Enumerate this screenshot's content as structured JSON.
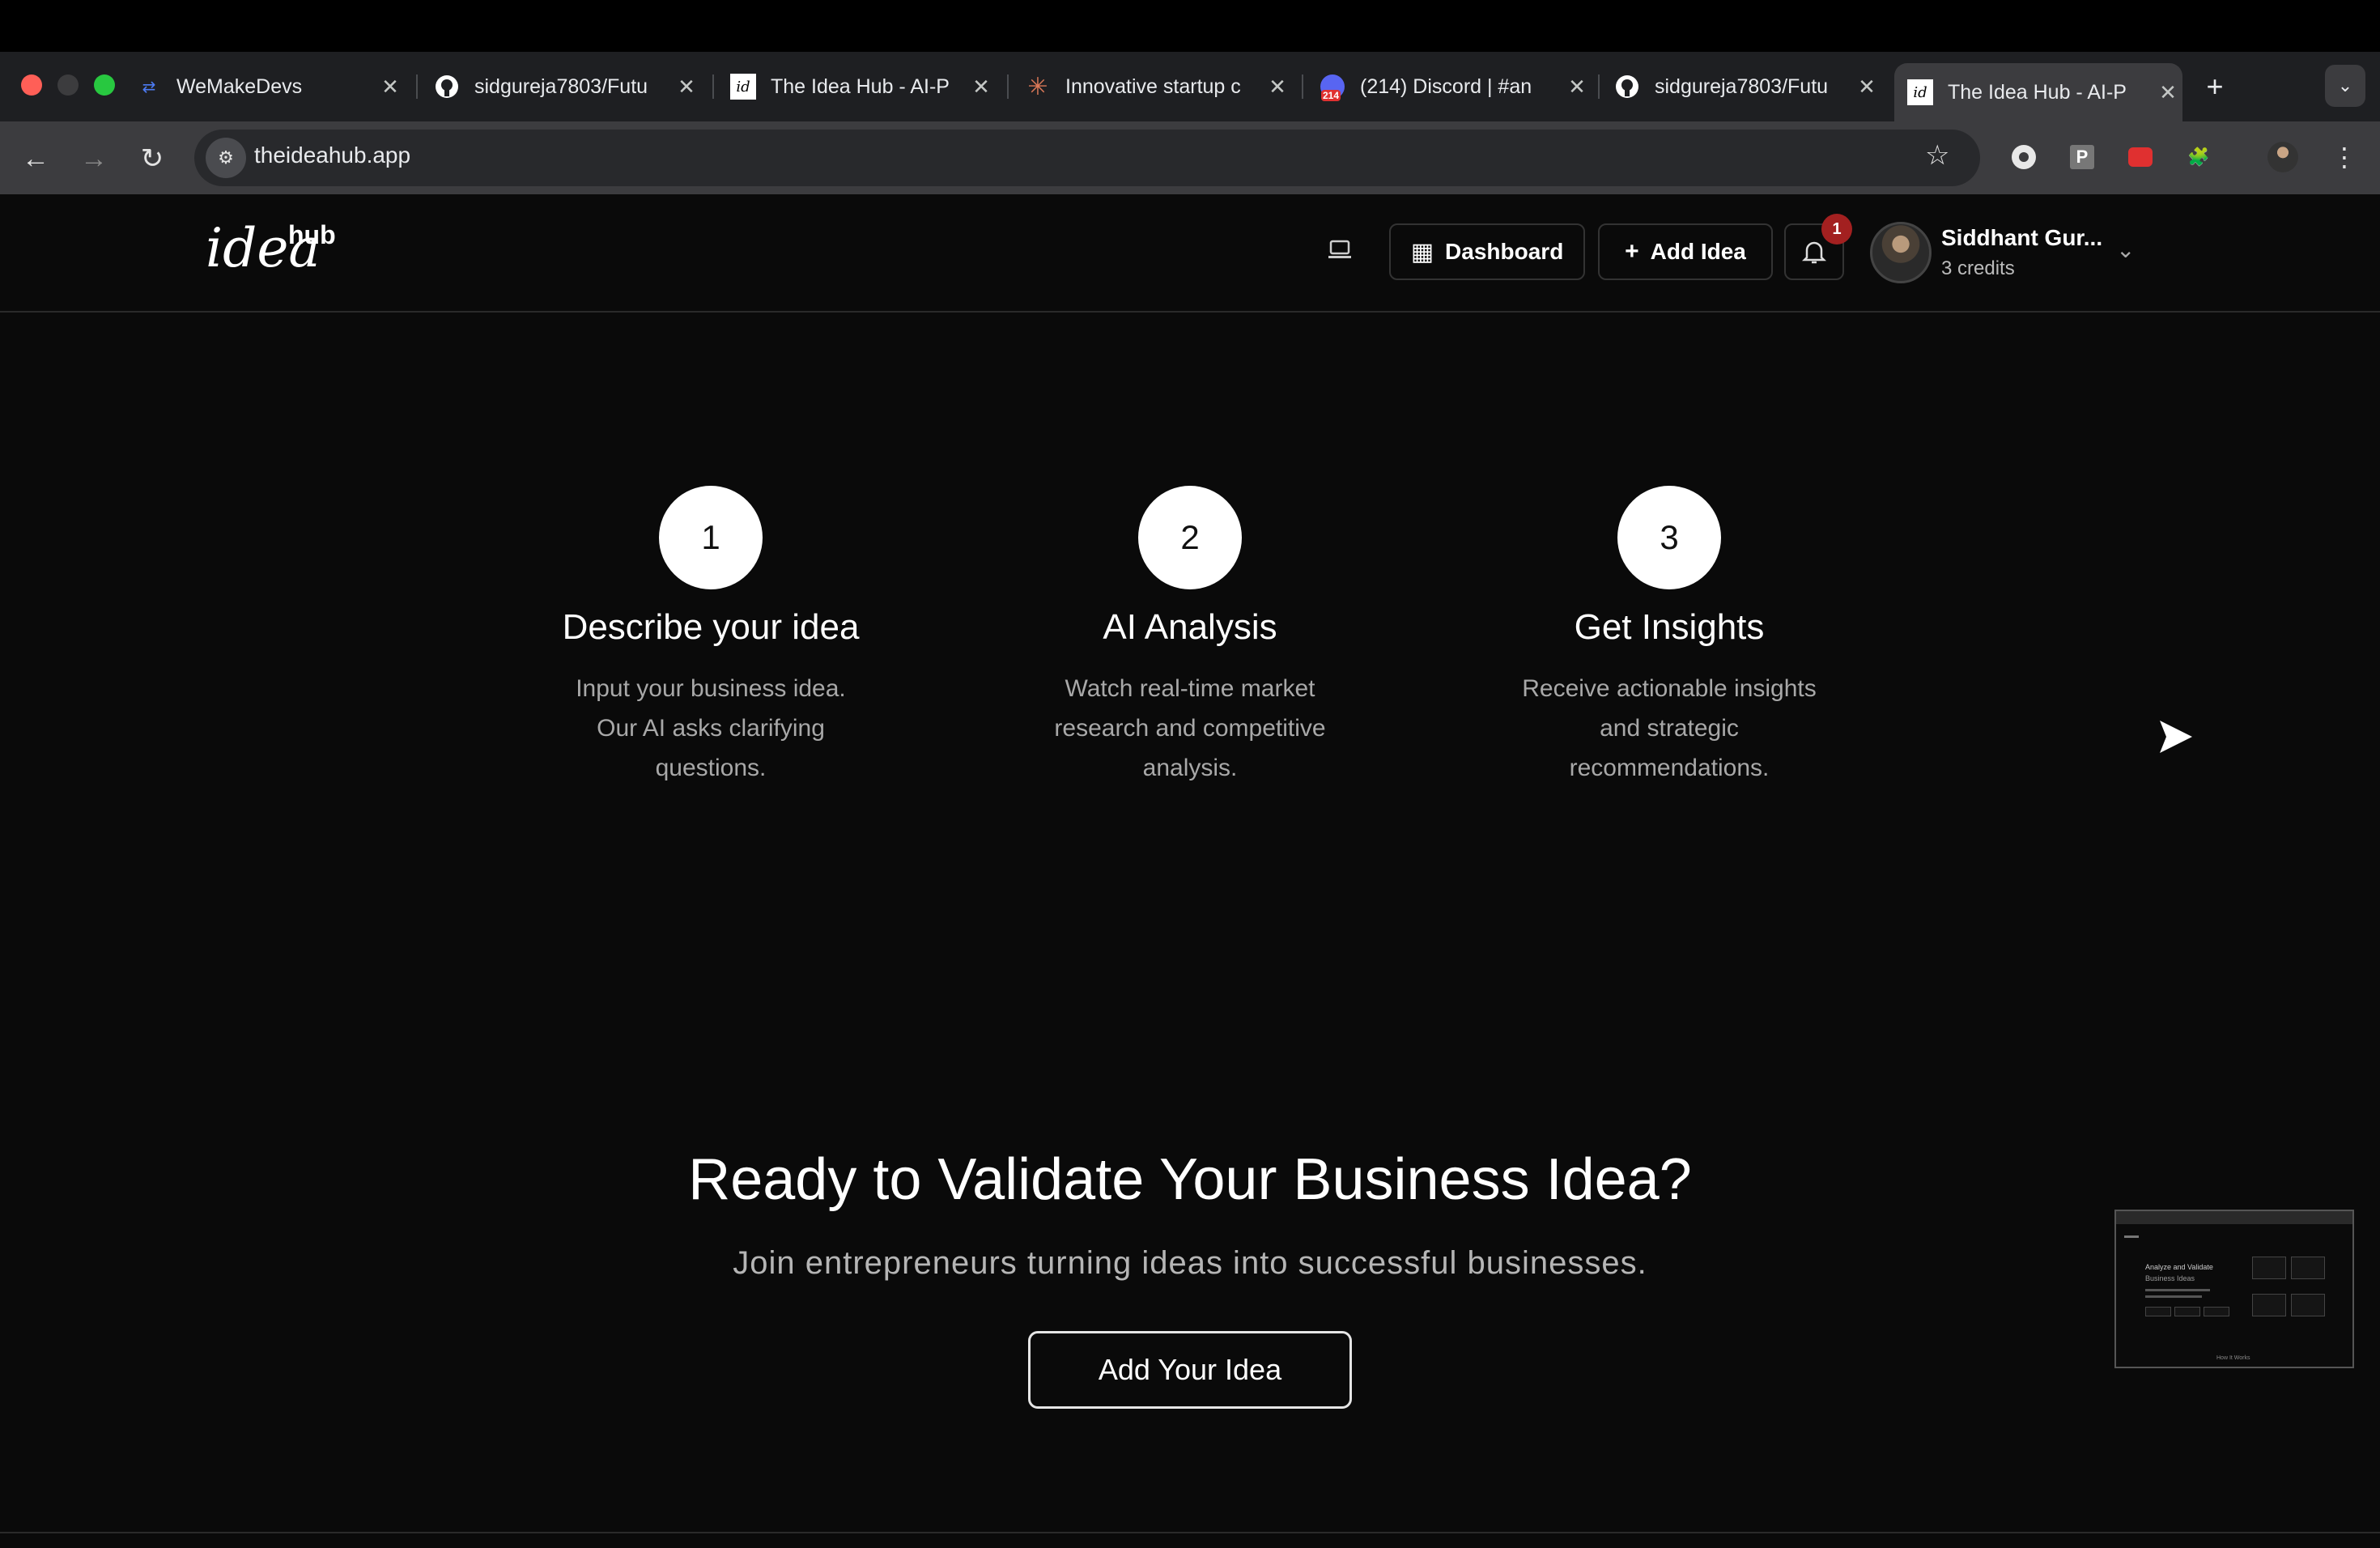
{
  "browser": {
    "tabs": [
      {
        "title": "WeMakeDevs",
        "icon": "wemakedevs-icon"
      },
      {
        "title": "sidgureja7803/Futu",
        "icon": "github-icon"
      },
      {
        "title": "The Idea Hub - AI-P",
        "icon": "ideahub-icon"
      },
      {
        "title": "Innovative startup c",
        "icon": "claude-icon"
      },
      {
        "title": "(214) Discord | #an",
        "icon": "discord-icon",
        "badge": "214"
      },
      {
        "title": "sidgureja7803/Futu",
        "icon": "github-icon"
      },
      {
        "title": "The Idea Hub - AI-P",
        "icon": "ideahub-icon",
        "active": true
      }
    ],
    "url": "theideahub.app",
    "extensions": [
      "perplexity-icon",
      "p-extension-icon",
      "youtube-extension-icon",
      "puzzle-icon",
      "profile-avatar",
      "more-menu-icon"
    ]
  },
  "header": {
    "logo_main": "idea",
    "logo_super": "hub",
    "dashboard_label": "Dashboard",
    "add_idea_label": "Add Idea",
    "notification_count": "1",
    "user_name": "Siddhant Gur...",
    "user_credits": "3 credits"
  },
  "steps": [
    {
      "number": "1",
      "title": "Describe your idea",
      "description": "Input your business idea. Our AI asks clarifying questions."
    },
    {
      "number": "2",
      "title": "AI Analysis",
      "description": "Watch real-time market research and competitive analysis."
    },
    {
      "number": "3",
      "title": "Get Insights",
      "description": "Receive actionable insights and strategic recommendations."
    }
  ],
  "cta": {
    "title": "Ready to Validate Your Business Idea?",
    "subtitle": "Join entrepreneurs turning ideas into successful businesses.",
    "button_label": "Add Your Idea"
  },
  "pip": {
    "heading": "Analyze and Validate",
    "subheading": "Business Ideas",
    "footer": "How It Works"
  },
  "colors": {
    "background": "#0a0a0a",
    "notification_badge": "#a32020",
    "muted_text": "#a8a8a8"
  }
}
